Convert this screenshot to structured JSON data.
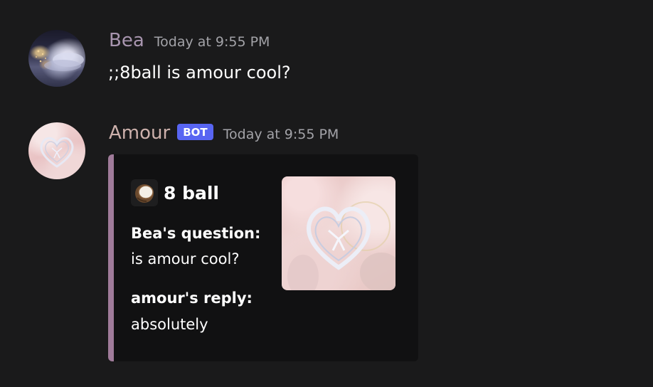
{
  "messages": [
    {
      "username": "Bea",
      "timestamp": "Today at 9:55 PM",
      "content": ";;8ball is amour cool?"
    },
    {
      "username": "Amour",
      "bot_tag": "BOT",
      "timestamp": "Today at 9:55 PM",
      "embed": {
        "icon": "coconut-icon",
        "title": "8 ball",
        "fields": [
          {
            "name": "Bea's question:",
            "value": "is amour cool?"
          },
          {
            "name": "amour's reply:",
            "value": "absolutely"
          }
        ],
        "accent_color": "#a07b9a"
      }
    }
  ],
  "colors": {
    "background": "#1a1a1b",
    "embed_background": "#111112",
    "bot_tag": "#5865f2",
    "username_bea": "#a895af",
    "username_amour": "#cdb1ac",
    "timestamp": "#a3a3a8"
  }
}
